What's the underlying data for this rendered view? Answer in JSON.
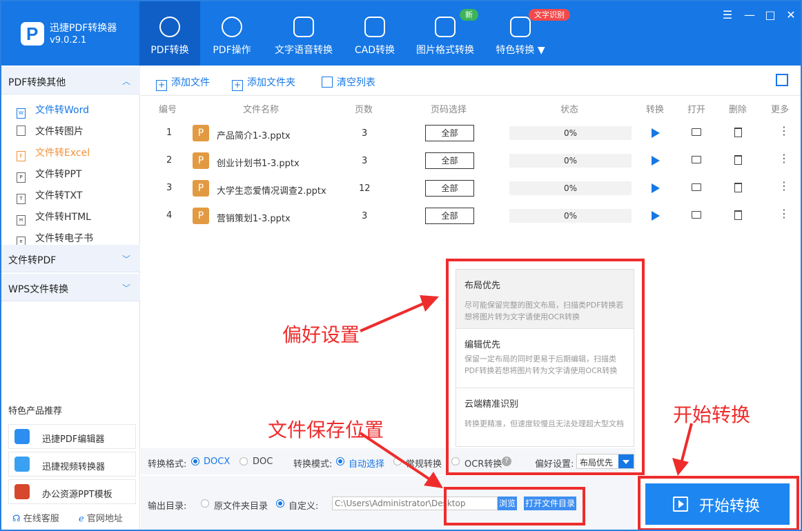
{
  "app": {
    "name": "迅捷PDF转换器",
    "version": "v9.0.2.1"
  },
  "nav": {
    "tabs": [
      {
        "label": "PDF转换"
      },
      {
        "label": "PDF操作"
      },
      {
        "label": "文字语音转换"
      },
      {
        "label": "CAD转换"
      },
      {
        "label": "图片格式转换"
      },
      {
        "label": "特色转换"
      }
    ],
    "badge_new": "新",
    "badge_ocr": "文字识别"
  },
  "sidebar": {
    "section1": "PDF转换其他",
    "items": [
      {
        "label": "文件转Word"
      },
      {
        "label": "文件转图片"
      },
      {
        "label": "文件转Excel"
      },
      {
        "label": "文件转PPT"
      },
      {
        "label": "文件转TXT"
      },
      {
        "label": "文件转HTML"
      },
      {
        "label": "文件转电子书"
      }
    ],
    "section2": "文件转PDF",
    "section3": "WPS文件转换",
    "promo_title": "特色产品推荐",
    "promos": [
      {
        "label": "迅捷PDF编辑器"
      },
      {
        "label": "迅捷视频转换器"
      },
      {
        "label": "办公资源PPT模板"
      }
    ],
    "online_service": "在线客服",
    "official_site": "官网地址"
  },
  "toolbar": {
    "add_file": "添加文件",
    "add_folder": "添加文件夹",
    "clear_list": "清空列表"
  },
  "table": {
    "headers": {
      "num": "编号",
      "name": "文件名称",
      "pages": "页数",
      "range": "页码选择",
      "status": "状态",
      "convert": "转换",
      "open": "打开",
      "delete": "删除",
      "more": "更多"
    },
    "rows": [
      {
        "num": "1",
        "icon": "P",
        "name": "产品简介1-3.pptx",
        "pages": "3",
        "range": "全部",
        "progress": "0%"
      },
      {
        "num": "2",
        "icon": "P",
        "name": "创业计划书1-3.pptx",
        "pages": "3",
        "range": "全部",
        "progress": "0%"
      },
      {
        "num": "3",
        "icon": "P",
        "name": "大学生恋爱情况调查2.pptx",
        "pages": "12",
        "range": "全部",
        "progress": "0%"
      },
      {
        "num": "4",
        "icon": "P",
        "name": "营销策划1-3.pptx",
        "pages": "3",
        "range": "全部",
        "progress": "0%"
      }
    ]
  },
  "options": {
    "format_label": "转换格式:",
    "docx": "DOCX",
    "doc": "DOC",
    "mode_label": "转换模式:",
    "auto": "自动选择",
    "normal": "常规转换",
    "ocr": "OCR转换",
    "pref_label": "偏好设置:",
    "pref_value": "布局优先"
  },
  "output": {
    "label": "输出目录:",
    "original": "原文件夹目录",
    "custom": "自定义:",
    "path": "C:\\Users\\Administrator\\Desktop",
    "browse": "浏览",
    "open_dir": "打开文件目录"
  },
  "popup": {
    "options": [
      {
        "title": "布局优先",
        "desc": "尽可能保留完整的图文布局，扫描类PDF转换若想将图片转为文字请使用OCR转换"
      },
      {
        "title": "编辑优先",
        "desc": "保留一定布局的同时更易于后期编辑，扫描类PDF转换若想将图片转为文字请使用OCR转换"
      },
      {
        "title": "云端精准识别",
        "desc": "转换更精准，但速度较慢且无法处理超大型文档"
      }
    ]
  },
  "annotations": {
    "pref": "偏好设置",
    "save": "文件保存位置",
    "start": "开始转换"
  },
  "start_button": "开始转换",
  "colors": {
    "primary": "#1677e5",
    "annotation": "#ee2c2c",
    "file_icon": "#e29a42"
  }
}
